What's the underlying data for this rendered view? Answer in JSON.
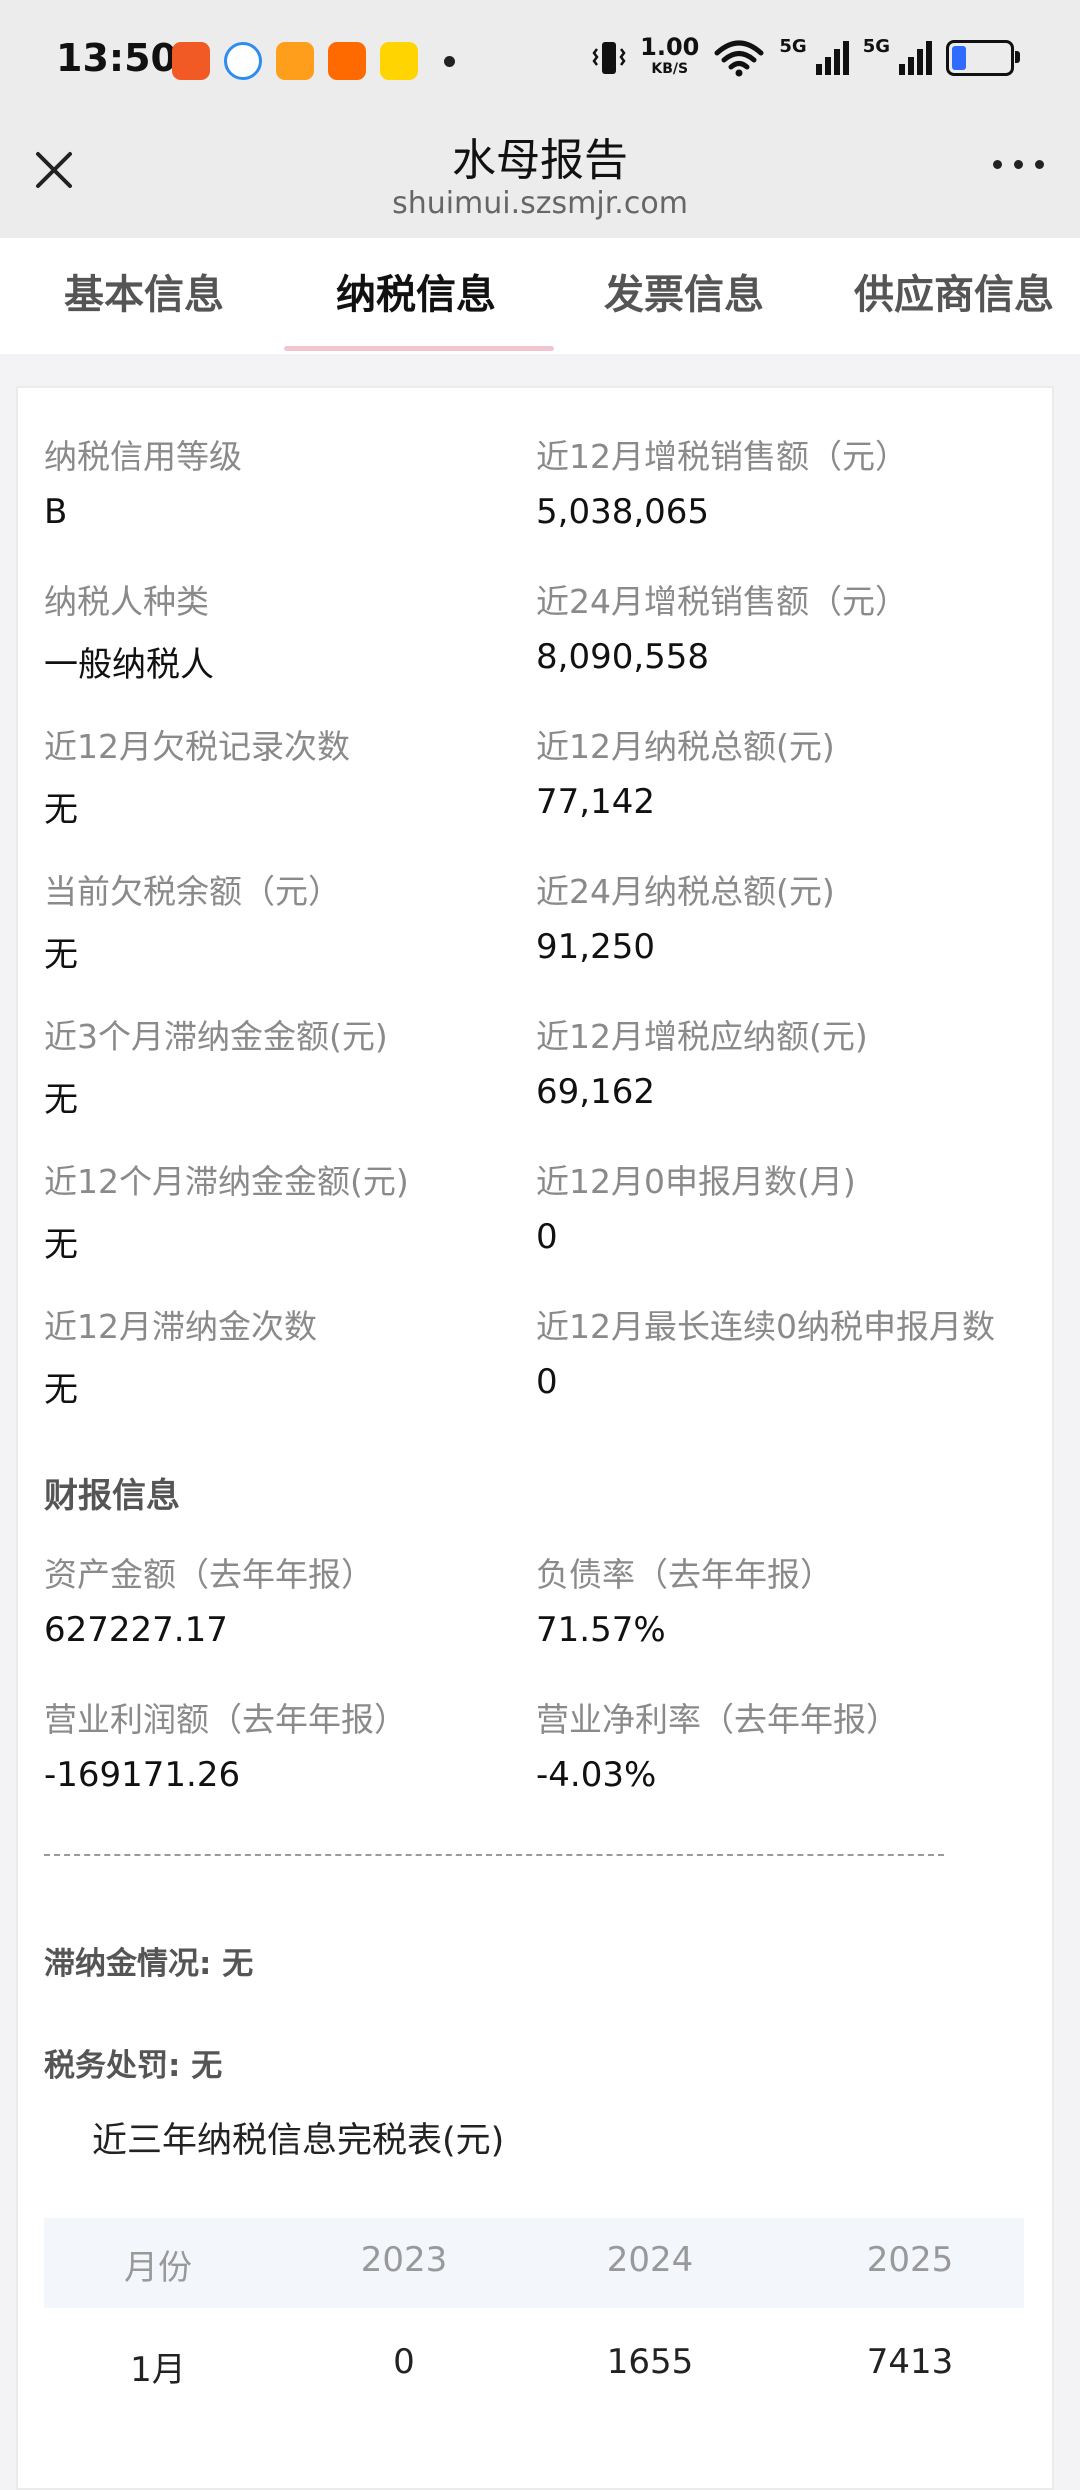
{
  "status": {
    "time": "13:50",
    "speed_value": "1.00",
    "speed_unit": "KB/S",
    "net1": "5G",
    "net2": "5G"
  },
  "title_bar": {
    "title": "水母报告",
    "url": "shuimui.szsmjr.com"
  },
  "tabs": [
    {
      "label": "基本信息",
      "active": false
    },
    {
      "label": "纳税信息",
      "active": true
    },
    {
      "label": "发票信息",
      "active": false
    },
    {
      "label": "供应商信息",
      "active": false
    }
  ],
  "tax_fields": [
    {
      "label": "纳税信用等级",
      "value": "B"
    },
    {
      "label": "近12月增税销售额（元）",
      "value": "5,038,065"
    },
    {
      "label": "纳税人种类",
      "value": "一般纳税人"
    },
    {
      "label": "近24月增税销售额（元）",
      "value": "8,090,558"
    },
    {
      "label": "近12月欠税记录次数",
      "value": "无"
    },
    {
      "label": "近12月纳税总额(元)",
      "value": "77,142"
    },
    {
      "label": "当前欠税余额（元）",
      "value": "无"
    },
    {
      "label": "近24月纳税总额(元)",
      "value": "91,250"
    },
    {
      "label": "近3个月滞纳金金额(元)",
      "value": "无"
    },
    {
      "label": "近12月增税应纳额(元)",
      "value": "69,162"
    },
    {
      "label": "近12个月滞纳金金额(元)",
      "value": "无"
    },
    {
      "label": "近12月0申报月数(月)",
      "value": "0"
    },
    {
      "label": "近12月滞纳金次数",
      "value": "无"
    },
    {
      "label": "近12月最长连续0纳税申报月数",
      "value": "0"
    }
  ],
  "finance": {
    "section_title": "财报信息",
    "fields": [
      {
        "label": "资产金额（去年年报）",
        "value": "627227.17"
      },
      {
        "label": "负债率（去年年报）",
        "value": "71.57%"
      },
      {
        "label": "营业利润额（去年年报）",
        "value": "-169171.26"
      },
      {
        "label": "营业净利率（去年年报）",
        "value": "-4.03%"
      }
    ]
  },
  "notes": {
    "late_fee": "滞纳金情况: 无",
    "penalty": "税务处罚: 无"
  },
  "tax_table": {
    "title": "近三年纳税信息完税表(元)",
    "headers": [
      "月份",
      "2023",
      "2024",
      "2025"
    ],
    "rows": [
      [
        "1月",
        "0",
        "1655",
        "7413"
      ]
    ]
  },
  "colors": {
    "tab_underline": "#f0c5d0",
    "battery_fill": "#2f6bff"
  }
}
